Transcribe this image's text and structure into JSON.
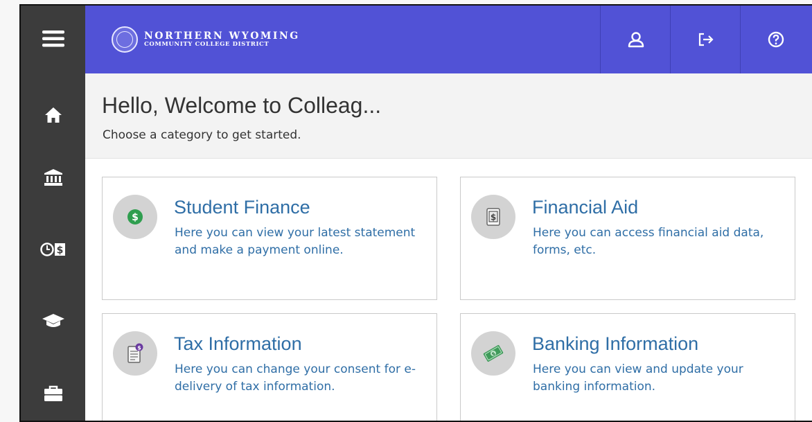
{
  "header": {
    "logo_line1": "NORTHERN WYOMING",
    "logo_line2": "COMMUNITY COLLEGE DISTRICT",
    "buttons": [
      "user-icon",
      "sign-out-icon",
      "help-icon"
    ]
  },
  "sidebar": {
    "items": [
      "menu-icon",
      "home-icon",
      "bank-icon",
      "clock-dollar-icon",
      "graduation-cap-icon",
      "briefcase-icon"
    ]
  },
  "welcome": {
    "title": "Hello, Welcome to Colleag...",
    "subtitle": "Choose a category to get started."
  },
  "cards": [
    {
      "title": "Student Finance",
      "description": "Here you can view your latest statement and make a payment online.",
      "icon": "dollar-circle-icon"
    },
    {
      "title": "Financial Aid",
      "description": "Here you can access financial aid data, forms, etc.",
      "icon": "dollar-document-icon"
    },
    {
      "title": "Tax Information",
      "description": "Here you can change your consent for e-delivery of tax information.",
      "icon": "tax-form-icon"
    },
    {
      "title": "Banking Information",
      "description": "Here you can view and update your banking information.",
      "icon": "cash-icon"
    }
  ],
  "colors": {
    "header": "#5152d6",
    "sidebar": "#3c3c3c",
    "link": "#2f6ea6"
  }
}
